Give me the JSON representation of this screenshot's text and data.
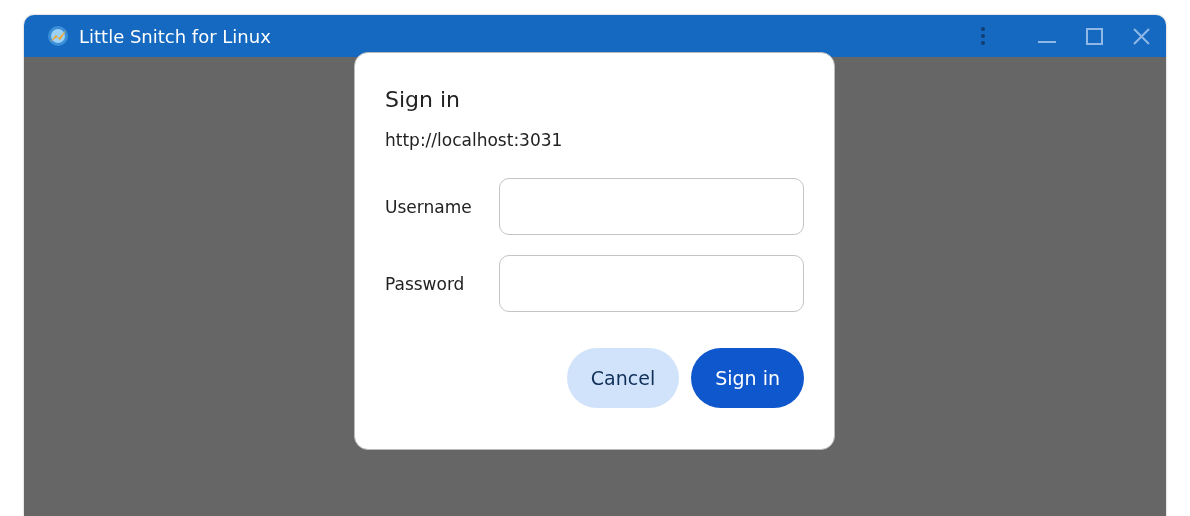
{
  "window": {
    "title": "Little Snitch for Linux"
  },
  "dialog": {
    "title": "Sign in",
    "origin": "http://localhost:3031",
    "fields": [
      {
        "label": "Username"
      },
      {
        "label": "Password"
      }
    ],
    "buttons": [
      {
        "label": "Cancel",
        "kind": "secondary"
      },
      {
        "label": "Sign in",
        "kind": "primary"
      }
    ]
  }
}
